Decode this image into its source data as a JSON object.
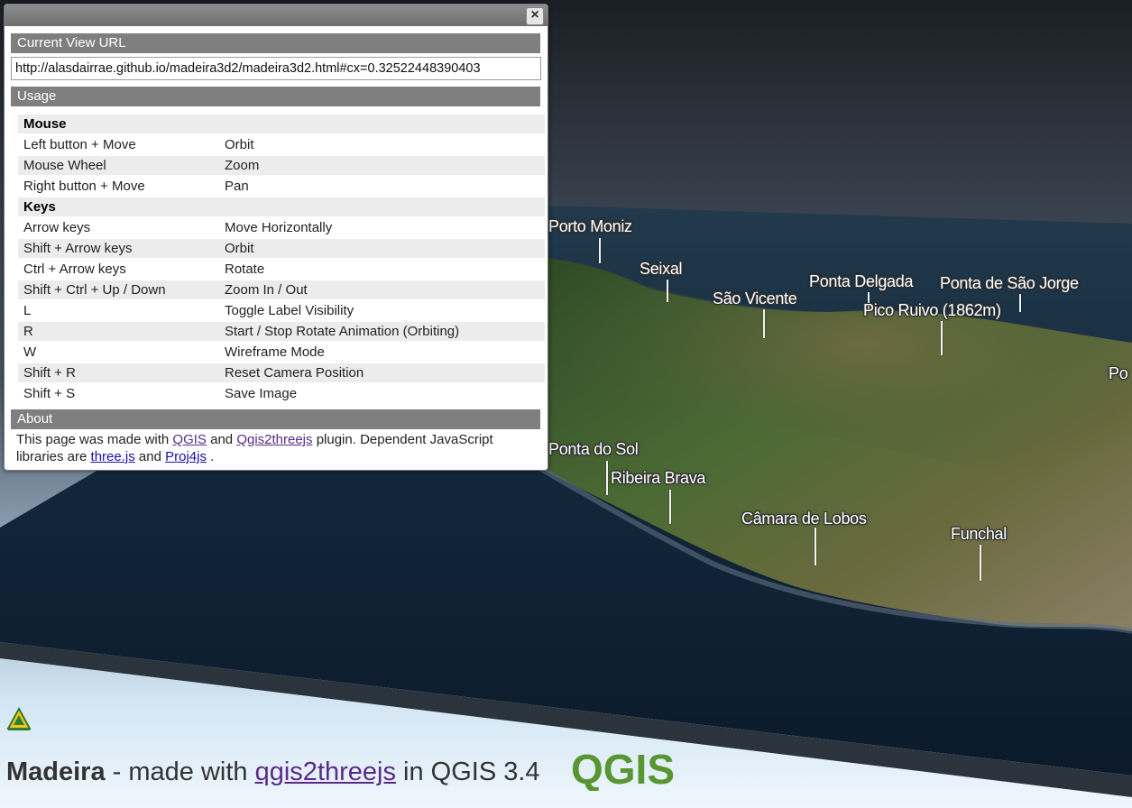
{
  "popup": {
    "close_glyph": "×",
    "url_section_title": "Current View URL",
    "url_value": "http://alasdairrae.github.io/madeira3d2/madeira3d2.html#cx=0.32522448390403",
    "usage_section_title": "Usage",
    "usage_rows": [
      {
        "key": "Mouse",
        "value": "",
        "head": true
      },
      {
        "key": "Left button + Move",
        "value": "Orbit"
      },
      {
        "key": "Mouse Wheel",
        "value": "Zoom"
      },
      {
        "key": "Right button + Move",
        "value": "Pan"
      },
      {
        "key": "Keys",
        "value": "",
        "head": true
      },
      {
        "key": "Arrow keys",
        "value": "Move Horizontally"
      },
      {
        "key": "Shift + Arrow keys",
        "value": "Orbit"
      },
      {
        "key": "Ctrl + Arrow keys",
        "value": "Rotate"
      },
      {
        "key": "Shift + Ctrl + Up / Down",
        "value": "Zoom In / Out"
      },
      {
        "key": "L",
        "value": "Toggle Label Visibility"
      },
      {
        "key": "R",
        "value": "Start / Stop Rotate Animation (Orbiting)"
      },
      {
        "key": "W",
        "value": "Wireframe Mode"
      },
      {
        "key": "Shift + R",
        "value": "Reset Camera Position"
      },
      {
        "key": "Shift + S",
        "value": "Save Image"
      }
    ],
    "about_section_title": "About",
    "about": {
      "t1": "This page was made with ",
      "link_qgis": "QGIS",
      "t2": " and ",
      "link_plugin": "Qgis2threejs",
      "t3": " plugin. Dependent JavaScript libraries are ",
      "link_three": "three.js",
      "t4": " and ",
      "link_proj": "Proj4js",
      "t5": " ."
    }
  },
  "map_labels": {
    "porto_moniz": "Porto Moniz",
    "seixal": "Seixal",
    "sao_vicente": "São Vicente",
    "ponta_delgada": "Ponta Delgada",
    "ponta_sao_jorge": "Ponta de São Jorge",
    "pico_ruivo": "Pico Ruivo (1862m)",
    "po_partial": "Po",
    "ponta_do_sol": "Ponta do Sol",
    "ribeira_brava": "Ribeira Brava",
    "camara_de_lobos": "Câmara de Lobos",
    "funchal": "Funchal"
  },
  "footer": {
    "title": "Madeira",
    "sep": " - made with ",
    "link": "qgis2threejs",
    "suffix": " in QGIS 3.4",
    "logo_text": "QGIS"
  },
  "colors": {
    "accent_link": "#1a0dab",
    "visited_link": "#5b2b8a",
    "qgis_green": "#589632",
    "section_header": "#7f7f7f"
  }
}
